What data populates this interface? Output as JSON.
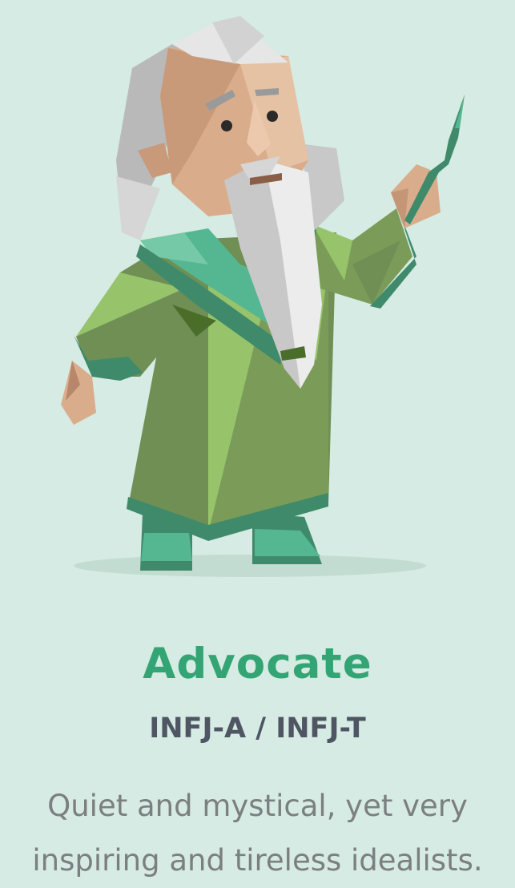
{
  "personality": {
    "name": "Advocate",
    "code": "INFJ-A / INFJ-T",
    "description": "Quiet and mystical, yet very inspiring and tireless idealists."
  },
  "illustration": {
    "icon": "advocate-wizard-character",
    "colors": {
      "background": "#d5ebe3",
      "robe_light": "#97c46b",
      "robe_mid": "#6f8f55",
      "robe_dark": "#4b6d2a",
      "robe_trim": "#3f8a6b",
      "collar": "#55b791",
      "skin": "#d9ad8c",
      "hair": "#c8c8c8",
      "beard": "#e9e9e9"
    }
  },
  "theme": {
    "title_color": "#33a474",
    "code_color": "#4f5562",
    "text_color": "#7c7f7f"
  }
}
